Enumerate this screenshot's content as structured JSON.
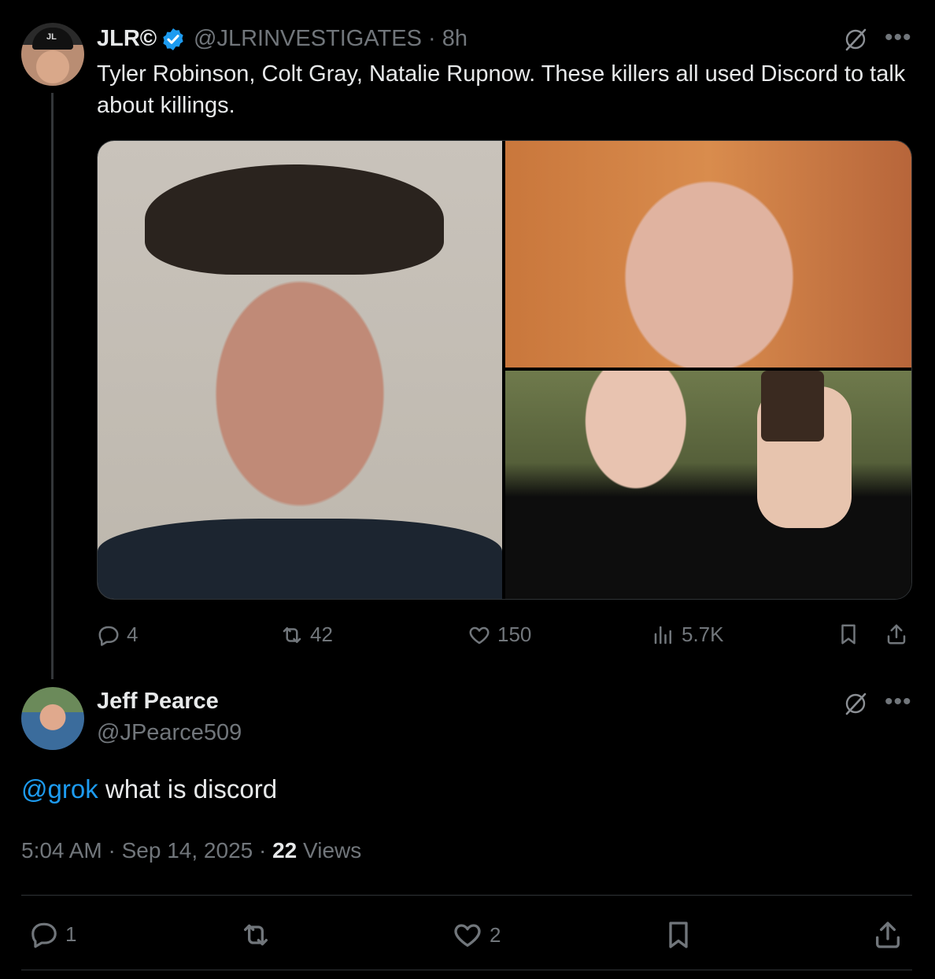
{
  "original_post": {
    "display_name": "JLR©",
    "handle": "@JLRINVESTIGATES",
    "time": "· 8h",
    "avatar_cap_text": "JL",
    "text": "Tyler Robinson, Colt Gray, Natalie Rupnow. These killers all used Discord to talk about killings.",
    "stats": {
      "replies": "4",
      "reposts": "42",
      "likes": "150",
      "views": "5.7K"
    }
  },
  "reply_post": {
    "display_name": "Jeff Pearce",
    "handle": "@JPearce509",
    "mention": "@grok",
    "text": " what is discord",
    "time": "5:04 AM",
    "date": "Sep 14, 2025",
    "views_count": "22",
    "views_label": "Views",
    "stats": {
      "replies": "1",
      "likes": "2"
    }
  },
  "icons": {
    "verified": "verified-badge-icon",
    "grok": "grok-icon",
    "more": "more-icon",
    "reply": "reply-icon",
    "repost": "repost-icon",
    "like": "like-icon",
    "views": "views-icon",
    "bookmark": "bookmark-icon",
    "share": "share-icon"
  },
  "colors": {
    "background": "#000000",
    "text_primary": "#e7e9ea",
    "text_secondary": "#71767b",
    "accent": "#1d9bf0",
    "divider": "#2f3336"
  }
}
